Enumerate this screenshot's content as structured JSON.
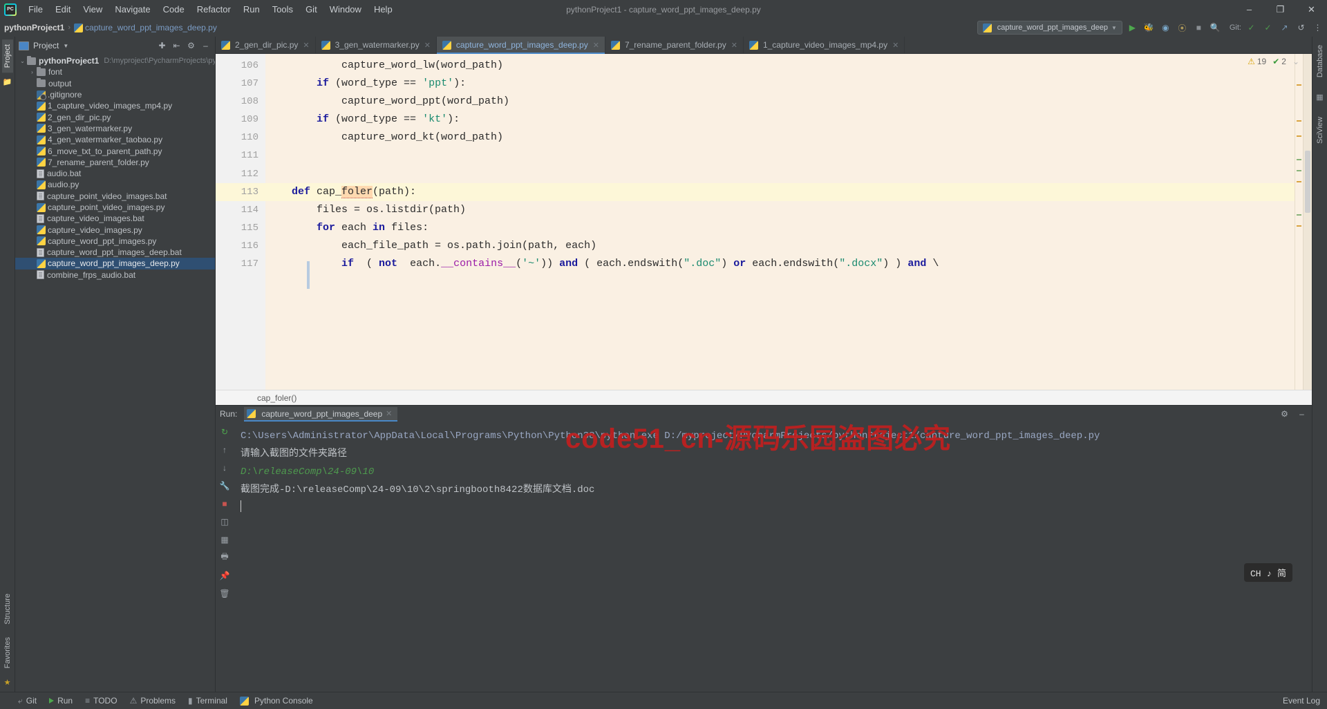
{
  "window": {
    "title": "pythonProject1 - capture_word_ppt_images_deep.py",
    "minimize": "–",
    "maximize": "❐",
    "close": "✕"
  },
  "menubar": {
    "logo": "pycharm-logo",
    "items": [
      "File",
      "Edit",
      "View",
      "Navigate",
      "Code",
      "Refactor",
      "Run",
      "Tools",
      "Git",
      "Window",
      "Help"
    ]
  },
  "navbar": {
    "project_name": "pythonProject1",
    "separator": "›",
    "file_name": "capture_word_ppt_images_deep.py",
    "run_config": "capture_word_ppt_images_deep",
    "run_config_caret": "▼",
    "git_label": "Git:",
    "icons": {
      "run": "▶",
      "debug": "🐞",
      "coverage": "⬤",
      "profile": "⦿",
      "stop": "■",
      "search": "🔍",
      "check": "✓",
      "check2": "✓",
      "arrow": "↗",
      "update": "↺",
      "more": "⋮"
    }
  },
  "left_rail": {
    "tabs": [
      "Project",
      "Structure",
      "Favorites"
    ],
    "icons": [
      "folder-icon",
      "star-icon"
    ]
  },
  "right_rail": {
    "tabs": [
      "Database",
      "SciView"
    ]
  },
  "project_panel": {
    "title": "Project",
    "caret": "▼",
    "header_icons": [
      "target-icon",
      "collapse-all-icon",
      "settings-icon",
      "hide-icon"
    ],
    "tree": [
      {
        "label": "pythonProject1",
        "path": "D:\\myproject\\PycharmProjects\\pytho",
        "icon": "folder",
        "indent": 0,
        "arrow": "⌄",
        "root": true
      },
      {
        "label": "font",
        "icon": "folder",
        "indent": 1,
        "arrow": "›"
      },
      {
        "label": "output",
        "icon": "folder",
        "indent": 1,
        "arrow": ""
      },
      {
        "label": ".gitignore",
        "icon": "gitignore",
        "indent": 1,
        "arrow": ""
      },
      {
        "label": "1_capture_video_images_mp4.py",
        "icon": "py",
        "indent": 1,
        "arrow": ""
      },
      {
        "label": "2_gen_dir_pic.py",
        "icon": "py",
        "indent": 1,
        "arrow": ""
      },
      {
        "label": "3_gen_watermarker.py",
        "icon": "py",
        "indent": 1,
        "arrow": ""
      },
      {
        "label": "4_gen_watermarker_taobao.py",
        "icon": "py",
        "indent": 1,
        "arrow": ""
      },
      {
        "label": "6_move_txt_to_parent_path.py",
        "icon": "py",
        "indent": 1,
        "arrow": ""
      },
      {
        "label": "7_rename_parent_folder.py",
        "icon": "py",
        "indent": 1,
        "arrow": ""
      },
      {
        "label": "audio.bat",
        "icon": "bat",
        "indent": 1,
        "arrow": ""
      },
      {
        "label": "audio.py",
        "icon": "py",
        "indent": 1,
        "arrow": ""
      },
      {
        "label": "capture_point_video_images.bat",
        "icon": "bat",
        "indent": 1,
        "arrow": ""
      },
      {
        "label": "capture_point_video_images.py",
        "icon": "py",
        "indent": 1,
        "arrow": ""
      },
      {
        "label": "capture_video_images.bat",
        "icon": "bat",
        "indent": 1,
        "arrow": ""
      },
      {
        "label": "capture_video_images.py",
        "icon": "py",
        "indent": 1,
        "arrow": ""
      },
      {
        "label": "capture_word_ppt_images.py",
        "icon": "py",
        "indent": 1,
        "arrow": ""
      },
      {
        "label": "capture_word_ppt_images_deep.bat",
        "icon": "bat",
        "indent": 1,
        "arrow": ""
      },
      {
        "label": "capture_word_ppt_images_deep.py",
        "icon": "py",
        "indent": 1,
        "arrow": "",
        "selected": true
      },
      {
        "label": "combine_frps_audio.bat",
        "icon": "bat",
        "indent": 1,
        "arrow": ""
      }
    ]
  },
  "editor": {
    "tabs": [
      {
        "label": "2_gen_dir_pic.py",
        "active": false
      },
      {
        "label": "3_gen_watermarker.py",
        "active": false
      },
      {
        "label": "capture_word_ppt_images_deep.py",
        "active": true
      },
      {
        "label": "7_rename_parent_folder.py",
        "active": false
      },
      {
        "label": "1_capture_video_images_mp4.py",
        "active": false
      }
    ],
    "close_glyph": "✕",
    "inspection": {
      "warning_icon": "⚠",
      "warning_count": "19",
      "ok_icon": "✔",
      "ok_count": "2",
      "chevron": "⌄"
    },
    "breadcrumb": "cap_foler()",
    "lines": [
      {
        "num": "106",
        "indent": 8,
        "current": false,
        "fold": "",
        "tokens": [
          {
            "t": "capture_word_lw(word_path)",
            "c": "fn"
          }
        ]
      },
      {
        "num": "107",
        "indent": 4,
        "current": false,
        "fold": "",
        "tokens": [
          {
            "t": "if",
            "c": "kw"
          },
          {
            "t": " (word_type == ",
            "c": "fn"
          },
          {
            "t": "'ppt'",
            "c": "str"
          },
          {
            "t": "):",
            "c": "fn"
          }
        ]
      },
      {
        "num": "108",
        "indent": 8,
        "current": false,
        "fold": "",
        "tokens": [
          {
            "t": "capture_word_ppt(word_path)",
            "c": "fn"
          }
        ]
      },
      {
        "num": "109",
        "indent": 4,
        "current": false,
        "fold": "",
        "tokens": [
          {
            "t": "if",
            "c": "kw"
          },
          {
            "t": " (word_type == ",
            "c": "fn"
          },
          {
            "t": "'kt'",
            "c": "str"
          },
          {
            "t": "):",
            "c": "fn"
          }
        ]
      },
      {
        "num": "110",
        "indent": 8,
        "current": false,
        "fold": "⬡",
        "tokens": [
          {
            "t": "capture_word_kt(word_path)",
            "c": "fn"
          }
        ]
      },
      {
        "num": "111",
        "indent": 0,
        "current": false,
        "fold": "",
        "tokens": []
      },
      {
        "num": "112",
        "indent": 0,
        "current": false,
        "fold": "",
        "tokens": []
      },
      {
        "num": "113",
        "indent": 0,
        "current": true,
        "fold": "▽",
        "tokens": [
          {
            "t": "def",
            "c": "kw"
          },
          {
            "t": " cap_",
            "c": "fn"
          },
          {
            "t": "foler",
            "c": "typo"
          },
          {
            "t": "(path):",
            "c": "fn"
          }
        ]
      },
      {
        "num": "114",
        "indent": 4,
        "current": false,
        "fold": "",
        "tokens": [
          {
            "t": "files = os.listdir(path)",
            "c": "fn"
          }
        ]
      },
      {
        "num": "115",
        "indent": 4,
        "current": false,
        "fold": "⬡",
        "tokens": [
          {
            "t": "for",
            "c": "kw"
          },
          {
            "t": " each ",
            "c": "fn"
          },
          {
            "t": "in",
            "c": "kw"
          },
          {
            "t": " files:",
            "c": "fn"
          }
        ]
      },
      {
        "num": "116",
        "indent": 8,
        "current": false,
        "fold": "",
        "tokens": [
          {
            "t": "each_file_path = os.path.join(path, each)",
            "c": "fn"
          }
        ]
      },
      {
        "num": "117",
        "indent": 8,
        "current": false,
        "fold": "",
        "tokens": [
          {
            "t": "if",
            "c": "kw"
          },
          {
            "t": "  ( ",
            "c": "fn"
          },
          {
            "t": "not",
            "c": "kw"
          },
          {
            "t": "  each.",
            "c": "fn"
          },
          {
            "t": "__contains__",
            "c": "dunder"
          },
          {
            "t": "(",
            "c": "fn"
          },
          {
            "t": "'~'",
            "c": "str"
          },
          {
            "t": ")) ",
            "c": "fn"
          },
          {
            "t": "and",
            "c": "kw"
          },
          {
            "t": " ( each.endswith(",
            "c": "fn"
          },
          {
            "t": "\".doc\"",
            "c": "str"
          },
          {
            "t": ") ",
            "c": "fn"
          },
          {
            "t": "or",
            "c": "kw"
          },
          {
            "t": " each.endswith(",
            "c": "fn"
          },
          {
            "t": "\".docx\"",
            "c": "str"
          },
          {
            "t": ") ) ",
            "c": "fn"
          },
          {
            "t": "and",
            "c": "kw"
          },
          {
            "t": " \\",
            "c": "fn"
          }
        ]
      }
    ]
  },
  "run_panel": {
    "label": "Run:",
    "tab_label": "capture_word_ppt_images_deep",
    "tab_close": "✕",
    "header_icons": [
      "settings-icon",
      "hide-icon"
    ],
    "side_icons": [
      "rerun-icon",
      "up-icon",
      "down-icon",
      "wrench-icon",
      "stop-icon",
      "layout-icon",
      "grid-icon",
      "print-icon",
      "pin-icon",
      "trash-icon"
    ],
    "console_lines": [
      {
        "text": "C:\\Users\\Administrator\\AppData\\Local\\Programs\\Python\\Python38\\python.exe D:/myproject/PycharmProjects/pythonProject1/capture_word_ppt_images_deep.py",
        "style": "link"
      },
      {
        "text": "请输入截图的文件夹路径",
        "style": "plain"
      },
      {
        "text": "D:\\releaseComp\\24-09\\10",
        "style": "green"
      },
      {
        "text": "截图完成-D:\\releaseComp\\24-09\\10\\2\\springbooth8422数据库文档.doc",
        "style": "plain"
      }
    ],
    "watermark": "code51_cn-源码乐园盗图必究",
    "ime_badge": "CH ♪ 简"
  },
  "statusbar": {
    "items": [
      {
        "label": "Git",
        "icon": "git-icon"
      },
      {
        "label": "Run",
        "icon": "run-icon"
      },
      {
        "label": "TODO",
        "icon": "todo-icon"
      },
      {
        "label": "Problems",
        "icon": "problems-icon"
      },
      {
        "label": "Terminal",
        "icon": "terminal-icon"
      },
      {
        "label": "Python Console",
        "icon": "python-console-icon"
      }
    ],
    "right": [
      {
        "label": "Event Log",
        "icon": "event-log-icon"
      }
    ]
  },
  "colors": {
    "chrome": "#3c3f41",
    "editor_bg": "#faf0e3",
    "selection": "#2f4f72",
    "accent": "#4a88c7",
    "watermark": "#c21f1f",
    "string": "#1a8a6f",
    "keyword": "#1a1a9c"
  }
}
